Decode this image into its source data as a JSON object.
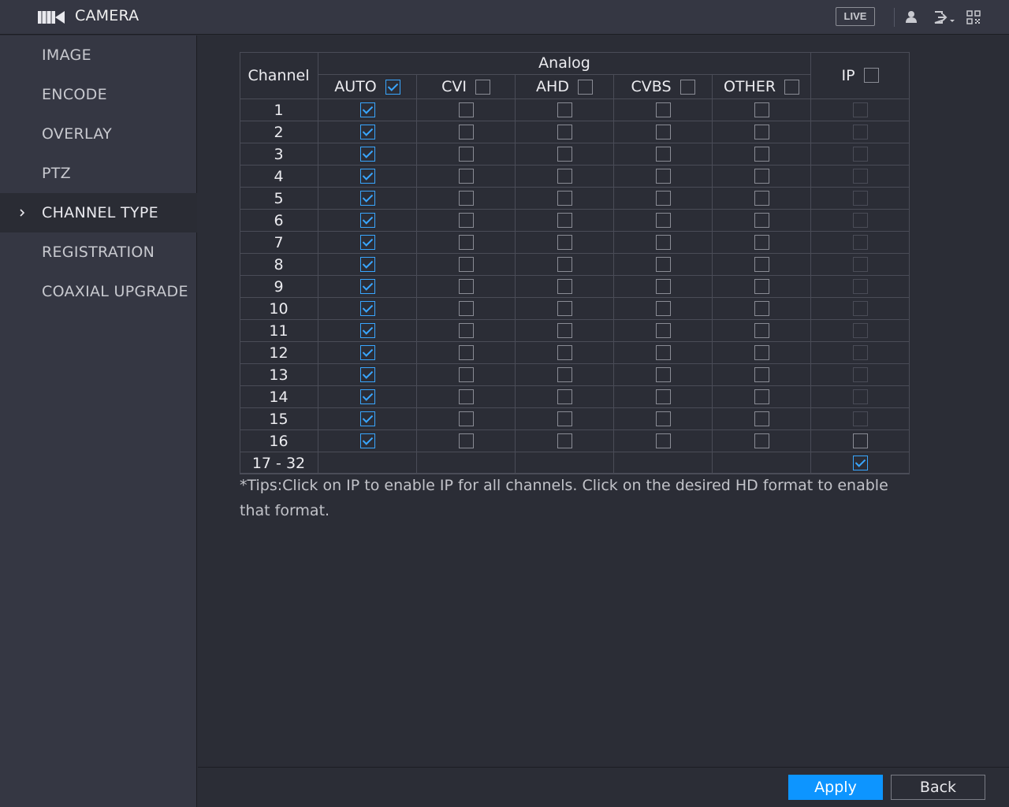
{
  "header": {
    "title": "CAMERA",
    "live_label": "LIVE",
    "icons": [
      "camera-icon",
      "user-icon",
      "logout-icon",
      "qr-code-icon"
    ]
  },
  "sidebar": {
    "items": [
      {
        "label": "IMAGE",
        "active": false
      },
      {
        "label": "ENCODE",
        "active": false
      },
      {
        "label": "OVERLAY",
        "active": false
      },
      {
        "label": "PTZ",
        "active": false
      },
      {
        "label": "CHANNEL TYPE",
        "active": true
      },
      {
        "label": "REGISTRATION",
        "active": false
      },
      {
        "label": "COAXIAL UPGRADE",
        "active": false
      }
    ]
  },
  "table": {
    "channel_header": "Channel",
    "analog_header": "Analog",
    "columns": [
      {
        "label": "AUTO",
        "checked": true
      },
      {
        "label": "CVI",
        "checked": false
      },
      {
        "label": "AHD",
        "checked": false
      },
      {
        "label": "CVBS",
        "checked": false
      },
      {
        "label": "OTHER",
        "checked": false
      }
    ],
    "ip_header": {
      "label": "IP",
      "checked": false
    },
    "rows": [
      {
        "channel": "1",
        "auto": true,
        "cvi": false,
        "ahd": false,
        "cvbs": false,
        "other": false,
        "ip": "disabled"
      },
      {
        "channel": "2",
        "auto": true,
        "cvi": false,
        "ahd": false,
        "cvbs": false,
        "other": false,
        "ip": "disabled"
      },
      {
        "channel": "3",
        "auto": true,
        "cvi": false,
        "ahd": false,
        "cvbs": false,
        "other": false,
        "ip": "disabled"
      },
      {
        "channel": "4",
        "auto": true,
        "cvi": false,
        "ahd": false,
        "cvbs": false,
        "other": false,
        "ip": "disabled"
      },
      {
        "channel": "5",
        "auto": true,
        "cvi": false,
        "ahd": false,
        "cvbs": false,
        "other": false,
        "ip": "disabled"
      },
      {
        "channel": "6",
        "auto": true,
        "cvi": false,
        "ahd": false,
        "cvbs": false,
        "other": false,
        "ip": "disabled"
      },
      {
        "channel": "7",
        "auto": true,
        "cvi": false,
        "ahd": false,
        "cvbs": false,
        "other": false,
        "ip": "disabled"
      },
      {
        "channel": "8",
        "auto": true,
        "cvi": false,
        "ahd": false,
        "cvbs": false,
        "other": false,
        "ip": "disabled"
      },
      {
        "channel": "9",
        "auto": true,
        "cvi": false,
        "ahd": false,
        "cvbs": false,
        "other": false,
        "ip": "disabled"
      },
      {
        "channel": "10",
        "auto": true,
        "cvi": false,
        "ahd": false,
        "cvbs": false,
        "other": false,
        "ip": "disabled"
      },
      {
        "channel": "11",
        "auto": true,
        "cvi": false,
        "ahd": false,
        "cvbs": false,
        "other": false,
        "ip": "disabled"
      },
      {
        "channel": "12",
        "auto": true,
        "cvi": false,
        "ahd": false,
        "cvbs": false,
        "other": false,
        "ip": "disabled"
      },
      {
        "channel": "13",
        "auto": true,
        "cvi": false,
        "ahd": false,
        "cvbs": false,
        "other": false,
        "ip": "disabled"
      },
      {
        "channel": "14",
        "auto": true,
        "cvi": false,
        "ahd": false,
        "cvbs": false,
        "other": false,
        "ip": "disabled"
      },
      {
        "channel": "15",
        "auto": true,
        "cvi": false,
        "ahd": false,
        "cvbs": false,
        "other": false,
        "ip": "disabled"
      },
      {
        "channel": "16",
        "auto": true,
        "cvi": false,
        "ahd": false,
        "cvbs": false,
        "other": false,
        "ip": "unchecked"
      },
      {
        "channel": "17 - 32",
        "auto": null,
        "cvi": null,
        "ahd": null,
        "cvbs": null,
        "other": null,
        "ip": "checked"
      }
    ]
  },
  "tips": "*Tips:Click on IP to enable IP for all channels. Click on the desired HD format to enable that format.",
  "footer": {
    "apply_label": "Apply",
    "back_label": "Back"
  },
  "colors": {
    "accent": "#39a6ff",
    "apply_button": "#0d95ff",
    "background": "#2b2d36",
    "sidebar": "#353743"
  }
}
